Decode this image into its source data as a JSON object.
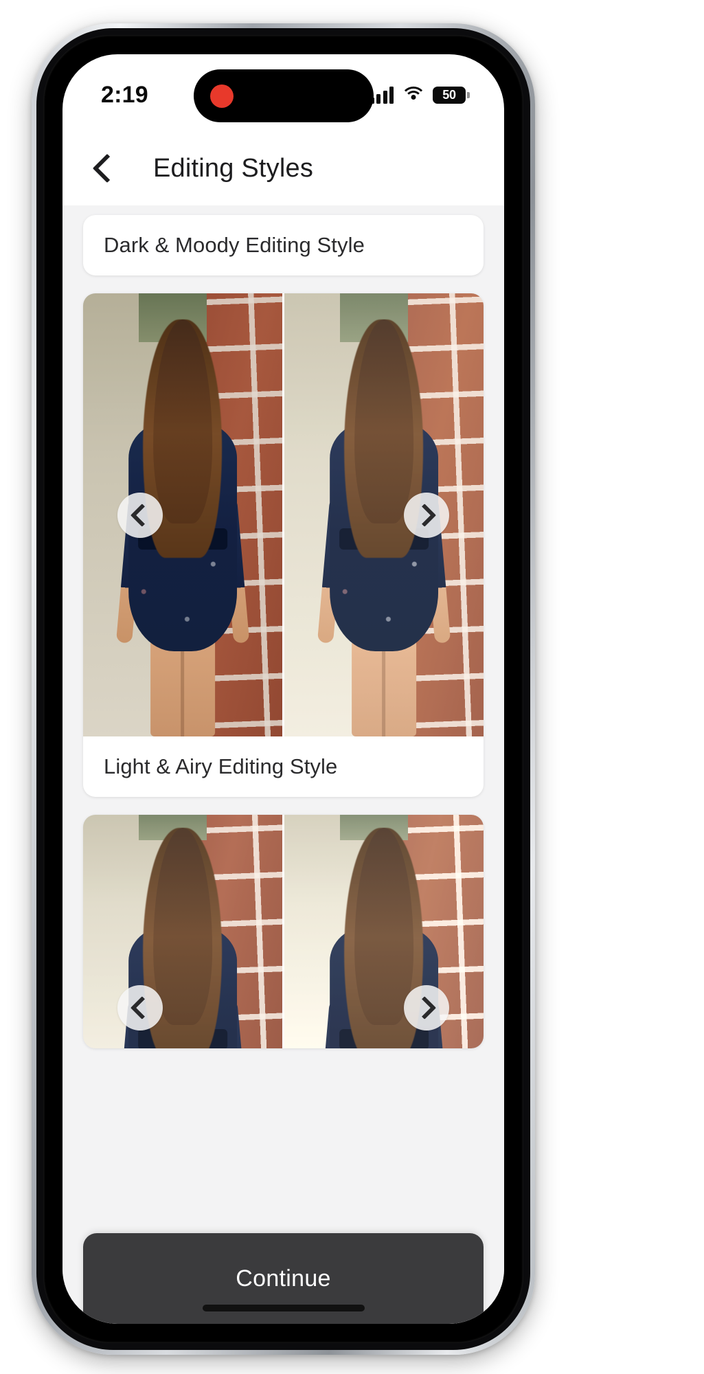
{
  "device": {
    "platform": "iphone",
    "frame_color": "#c9ccd1"
  },
  "status_bar": {
    "time": "2:19",
    "recording_indicator": "red-dot",
    "signal_icon": "cellular-signal-icon",
    "signal_bars": 4,
    "wifi_icon": "wifi-icon",
    "battery_icon": "battery-icon",
    "battery_percent": "50"
  },
  "nav": {
    "back_icon": "chevron-left-icon",
    "title": "Editing Styles"
  },
  "styles": [
    {
      "id": "dark-moody",
      "label": "Dark & Moody Editing Style",
      "label_position": "top",
      "prev_icon": "chevron-left-icon",
      "next_icon": "chevron-right-icon"
    },
    {
      "id": "light-airy",
      "label": "Light & Airy Editing Style",
      "label_position": "bottom",
      "prev_icon": "chevron-left-icon",
      "next_icon": "chevron-right-icon"
    },
    {
      "id": "third-style",
      "label": "",
      "label_position": "none",
      "prev_icon": "chevron-left-icon",
      "next_icon": "chevron-right-icon"
    }
  ],
  "footer": {
    "continue_label": "Continue",
    "continue_bg": "#3b3b3d",
    "continue_text_color": "#ffffff"
  },
  "colors": {
    "page_bg": "#f3f3f4",
    "card_bg": "#ffffff",
    "text_primary": "#1d1d1f",
    "text_secondary": "#2b2b2d",
    "accent_record": "#e8392b"
  }
}
